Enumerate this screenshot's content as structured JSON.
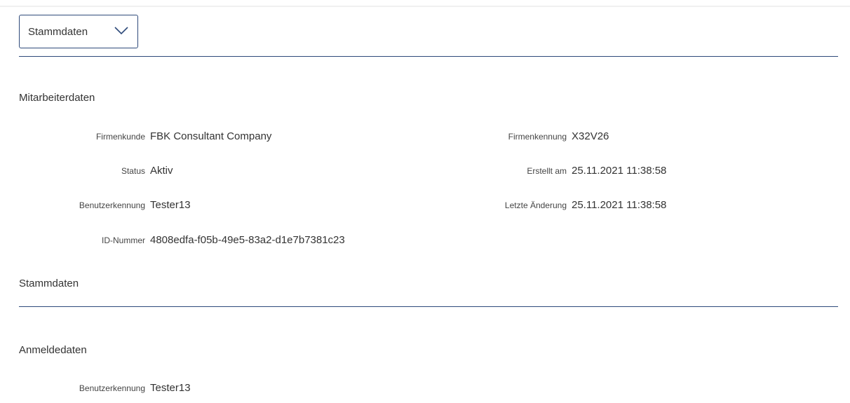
{
  "dropdown": {
    "selected": "Stammdaten"
  },
  "mitarbeiterdaten": {
    "title": "Mitarbeiterdaten",
    "left": [
      {
        "label": "Firmenkunde",
        "value": "FBK Consultant Company"
      },
      {
        "label": "Status",
        "value": "Aktiv"
      },
      {
        "label": "Benutzerkennung",
        "value": "Tester13"
      },
      {
        "label": "ID-Nummer",
        "value": "4808edfa-f05b-49e5-83a2-d1e7b7381c23"
      }
    ],
    "right": [
      {
        "label": "Firmenkennung",
        "value": "X32V26"
      },
      {
        "label": "Erstellt am",
        "value": "25.11.2021 11:38:58"
      },
      {
        "label": "Letzte Änderung",
        "value": "25.11.2021 11:38:58"
      }
    ]
  },
  "stammdaten": {
    "title": "Stammdaten"
  },
  "anmeldedaten": {
    "title": "Anmeldedaten",
    "fields": [
      {
        "label": "Benutzerkennung",
        "value": "Tester13"
      }
    ]
  }
}
